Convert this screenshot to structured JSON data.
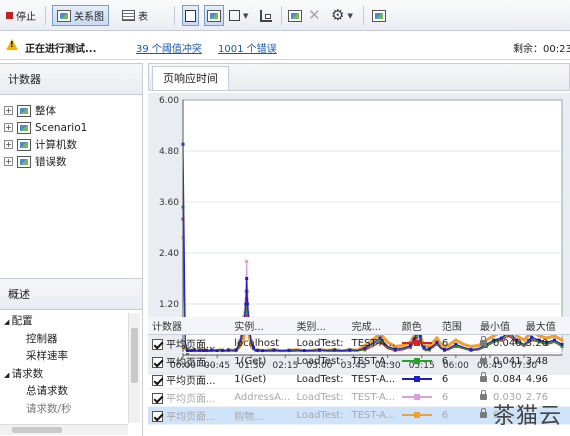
{
  "toolbar": {
    "stop_label": "停止",
    "graph_label": "关系图",
    "table_label": "表"
  },
  "status": {
    "running": "正在进行测试...",
    "threshold_link": "39 个阈值冲突",
    "error_link": "1001 个错误",
    "remaining": "剩余：00:23"
  },
  "counters_panel": {
    "title": "计数器",
    "items": [
      {
        "label": "整体"
      },
      {
        "label": "Scenario1"
      },
      {
        "label": "计算机数"
      },
      {
        "label": "错误数"
      }
    ]
  },
  "overview_panel": {
    "title": "概述",
    "items": [
      {
        "label": "配置",
        "level": 0
      },
      {
        "label": "控制器",
        "level": 1
      },
      {
        "label": "采样速率",
        "level": 1
      },
      {
        "label": "请求数",
        "level": 0
      },
      {
        "label": "总请求数",
        "level": 1
      },
      {
        "label": "请求数/秒",
        "level": 1
      }
    ]
  },
  "chart_panel": {
    "tab_label": "页响应时间"
  },
  "chart_data": {
    "type": "line",
    "y_ticks": [
      "6.00",
      "4.80",
      "3.60",
      "2.40",
      "1.20",
      "0"
    ],
    "x_ticks": [
      "00:00",
      "00:45",
      "01:30",
      "02:15",
      "03:00",
      "03:45",
      "04:30",
      "05:15",
      "06:00",
      "06:45",
      "07:30"
    ],
    "ylim": [
      0,
      6
    ],
    "x_minutes": [
      0,
      3,
      6,
      9,
      11,
      12,
      15,
      18,
      22,
      25,
      27,
      29,
      31,
      34,
      38,
      42,
      45,
      48,
      52,
      55,
      60,
      65,
      70,
      75,
      80,
      83,
      84,
      85,
      88,
      90,
      93,
      95,
      98,
      100,
      105,
      110,
      120,
      130,
      140,
      150,
      160,
      170,
      180,
      190,
      200,
      210,
      220,
      230,
      240,
      250,
      260,
      270,
      280,
      290,
      300,
      305,
      308,
      310,
      313,
      315,
      318,
      320,
      325,
      330,
      335,
      340,
      345,
      350,
      360,
      370,
      380,
      390,
      400,
      410,
      420,
      430,
      440,
      450,
      460,
      470,
      480,
      490,
      500
    ],
    "series": [
      {
        "name": "平均页面...",
        "instance": "localhost",
        "category": "LoadTest:",
        "completion": "TEST-A...",
        "color": "#d62728",
        "range": "6",
        "min": "0.040",
        "max": "3.20",
        "values": [
          3.2,
          0.18,
          0.05,
          0.1,
          0.1,
          0.06,
          0.08,
          0.07,
          0.09,
          0.08,
          0.1,
          0.08,
          0.09,
          0.08,
          0.1,
          0.09,
          0.08,
          0.1,
          0.09,
          0.1,
          0.09,
          0.1,
          0.08,
          0.2,
          0.55,
          0.9,
          1.3,
          0.9,
          0.5,
          0.3,
          0.15,
          0.09,
          0.1,
          0.08,
          0.09,
          0.08,
          0.09,
          0.1,
          0.08,
          0.09,
          0.1,
          0.08,
          0.1,
          0.09,
          0.08,
          0.1,
          0.09,
          0.1,
          0.12,
          0.2,
          0.3,
          0.15,
          0.1,
          0.12,
          0.18,
          0.3,
          0.4,
          0.55,
          0.35,
          0.2,
          0.15,
          0.1,
          0.12,
          0.18,
          0.25,
          0.15,
          0.1,
          0.12,
          0.2,
          0.15,
          0.1,
          0.12,
          0.2,
          0.3,
          0.35,
          0.45,
          0.3,
          0.2,
          0.35,
          0.3,
          0.25,
          0.3,
          0.2
        ]
      },
      {
        "name": "平均页面...",
        "instance": "1(Get)",
        "category": "LoadTest:",
        "completion": "TEST-A...",
        "color": "#2ca02c",
        "range": "6",
        "min": "0.041",
        "max": "3.48",
        "values": [
          3.48,
          0.2,
          0.05,
          0.09,
          0.1,
          0.07,
          0.08,
          0.09,
          0.08,
          0.09,
          0.1,
          0.08,
          0.1,
          0.09,
          0.08,
          0.1,
          0.09,
          0.1,
          0.08,
          0.09,
          0.1,
          0.09,
          0.1,
          0.25,
          0.6,
          1.0,
          1.5,
          1.0,
          0.55,
          0.3,
          0.15,
          0.1,
          0.09,
          0.1,
          0.08,
          0.09,
          0.1,
          0.08,
          0.09,
          0.1,
          0.08,
          0.09,
          0.1,
          0.09,
          0.1,
          0.08,
          0.1,
          0.09,
          0.14,
          0.25,
          0.35,
          0.18,
          0.12,
          0.14,
          0.2,
          0.35,
          0.45,
          0.6,
          0.4,
          0.22,
          0.16,
          0.11,
          0.13,
          0.2,
          0.28,
          0.16,
          0.11,
          0.13,
          0.22,
          0.16,
          0.11,
          0.13,
          0.22,
          0.32,
          0.38,
          0.5,
          0.32,
          0.22,
          0.38,
          0.32,
          0.27,
          0.32,
          0.22
        ]
      },
      {
        "name": "平均页面...",
        "instance": "1(Get)",
        "category": "LoadTest:",
        "completion": "TEST-A...",
        "color": "#1f1fbf",
        "range": "6",
        "min": "0.084",
        "max": "4.96",
        "values": [
          4.96,
          0.3,
          0.1,
          0.12,
          0.1,
          0.11,
          0.12,
          0.1,
          0.11,
          0.12,
          0.1,
          0.12,
          0.11,
          0.1,
          0.12,
          0.11,
          0.1,
          0.12,
          0.11,
          0.1,
          0.12,
          0.11,
          0.12,
          0.3,
          0.7,
          1.2,
          1.8,
          1.2,
          0.6,
          0.3,
          0.18,
          0.12,
          0.11,
          0.12,
          0.1,
          0.11,
          0.12,
          0.1,
          0.11,
          0.12,
          0.1,
          0.11,
          0.12,
          0.11,
          0.12,
          0.1,
          0.12,
          0.11,
          0.16,
          0.28,
          0.4,
          0.2,
          0.14,
          0.16,
          0.22,
          0.38,
          0.5,
          0.7,
          0.45,
          0.25,
          0.18,
          0.13,
          0.15,
          0.22,
          0.3,
          0.18,
          0.13,
          0.15,
          0.25,
          0.18,
          0.13,
          0.15,
          0.25,
          0.35,
          0.4,
          0.55,
          0.35,
          0.25,
          0.42,
          0.35,
          0.3,
          0.35,
          0.25
        ]
      },
      {
        "name": "平均页面...",
        "instance": "AddressA...",
        "category": "LoadTest:",
        "completion": "TEST-A...",
        "color": "#d9a0d9",
        "range": "6",
        "min": "0.030",
        "max": "2.76",
        "faded": true,
        "values": [
          2.76,
          0.2,
          0.06,
          0.1,
          0.09,
          0.08,
          0.1,
          0.09,
          0.08,
          0.1,
          0.09,
          0.1,
          0.08,
          0.09,
          0.1,
          0.08,
          0.09,
          0.1,
          0.08,
          0.1,
          0.09,
          0.1,
          0.08,
          0.35,
          0.9,
          1.5,
          2.2,
          1.5,
          0.7,
          0.35,
          0.18,
          0.1,
          0.09,
          0.1,
          0.08,
          0.09,
          0.1,
          0.08,
          0.09,
          0.1,
          0.08,
          0.09,
          0.1,
          0.09,
          0.1,
          0.08,
          0.1,
          0.09,
          0.14,
          0.24,
          0.32,
          0.16,
          0.11,
          0.13,
          0.2,
          0.32,
          0.45,
          0.6,
          0.38,
          0.2,
          0.15,
          0.1,
          0.12,
          0.2,
          0.26,
          0.15,
          0.1,
          0.12,
          0.2,
          0.15,
          0.1,
          0.12,
          0.2,
          0.3,
          0.36,
          0.45,
          0.3,
          0.2,
          0.36,
          0.3,
          0.25,
          0.3,
          0.2
        ]
      },
      {
        "name": "平均页面...",
        "instance": "购物...",
        "category": "LoadTest:",
        "completion": "TEST-A...",
        "color": "#f0a030",
        "range": "6",
        "min": "0.0...",
        "max": "",
        "faded": true,
        "selected": true,
        "values": [
          0.2,
          0.15,
          0.1,
          0.12,
          0.1,
          0.11,
          0.12,
          0.1,
          0.11,
          0.12,
          0.1,
          0.12,
          0.11,
          0.1,
          0.12,
          0.11,
          0.1,
          0.12,
          0.11,
          0.1,
          0.12,
          0.11,
          0.12,
          0.2,
          0.4,
          0.7,
          1.0,
          0.7,
          0.4,
          0.2,
          0.15,
          0.12,
          0.11,
          0.12,
          0.1,
          0.11,
          0.12,
          0.1,
          0.11,
          0.12,
          0.1,
          0.11,
          0.12,
          0.11,
          0.12,
          0.1,
          0.12,
          0.11,
          0.22,
          0.35,
          0.5,
          0.3,
          0.2,
          0.22,
          0.3,
          0.45,
          0.55,
          0.8,
          0.5,
          0.32,
          0.25,
          0.2,
          0.22,
          0.3,
          0.4,
          0.25,
          0.2,
          0.22,
          0.35,
          0.25,
          0.2,
          0.22,
          0.35,
          0.45,
          0.55,
          0.7,
          0.45,
          0.35,
          0.55,
          0.45,
          0.4,
          0.45,
          0.35
        ]
      }
    ]
  },
  "legend_table": {
    "headers": [
      "计数器",
      "实例...",
      "类别...",
      "完成...",
      "颜色",
      "范围",
      "最小值",
      "最大值"
    ]
  },
  "watermark": "茶猫云"
}
